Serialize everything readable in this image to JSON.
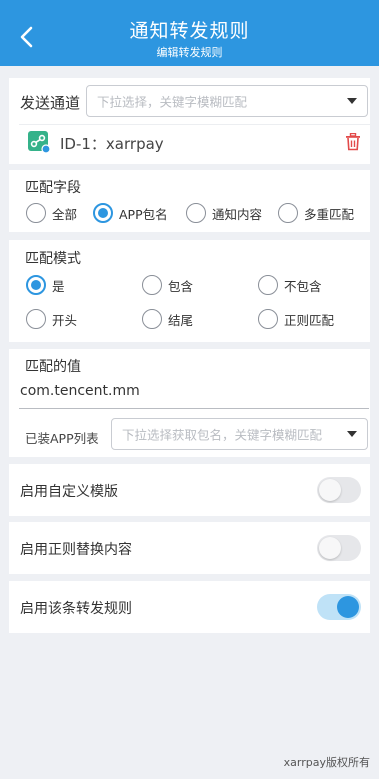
{
  "header": {
    "title": "通知转发规则",
    "subtitle": "编辑转发规则"
  },
  "channel": {
    "label": "发送通道",
    "placeholder": "下拉选择，关键字模糊匹配",
    "selected_item": "ID-1：xarrpay"
  },
  "match_field": {
    "label": "匹配字段",
    "options": [
      "全部",
      "APP包名",
      "通知内容",
      "多重匹配"
    ],
    "selected": "APP包名"
  },
  "match_mode": {
    "label": "匹配模式",
    "options": [
      "是",
      "包含",
      "不包含",
      "开头",
      "结尾",
      "正则匹配"
    ],
    "selected": "是"
  },
  "match_value": {
    "label": "匹配的值",
    "value": "com.tencent.mm",
    "app_list_label": "已装APP列表",
    "app_list_placeholder": "下拉选择获取包名，关键字模糊匹配"
  },
  "toggles": [
    {
      "label": "启用自定义模版",
      "on": false
    },
    {
      "label": "启用正则替换内容",
      "on": false
    },
    {
      "label": "启用该条转发规则",
      "on": true
    }
  ],
  "footer": "xarrpay版权所有",
  "colors": {
    "accent": "#2d96e0",
    "delete": "#e24a4a",
    "icon_green": "#35b28a"
  }
}
